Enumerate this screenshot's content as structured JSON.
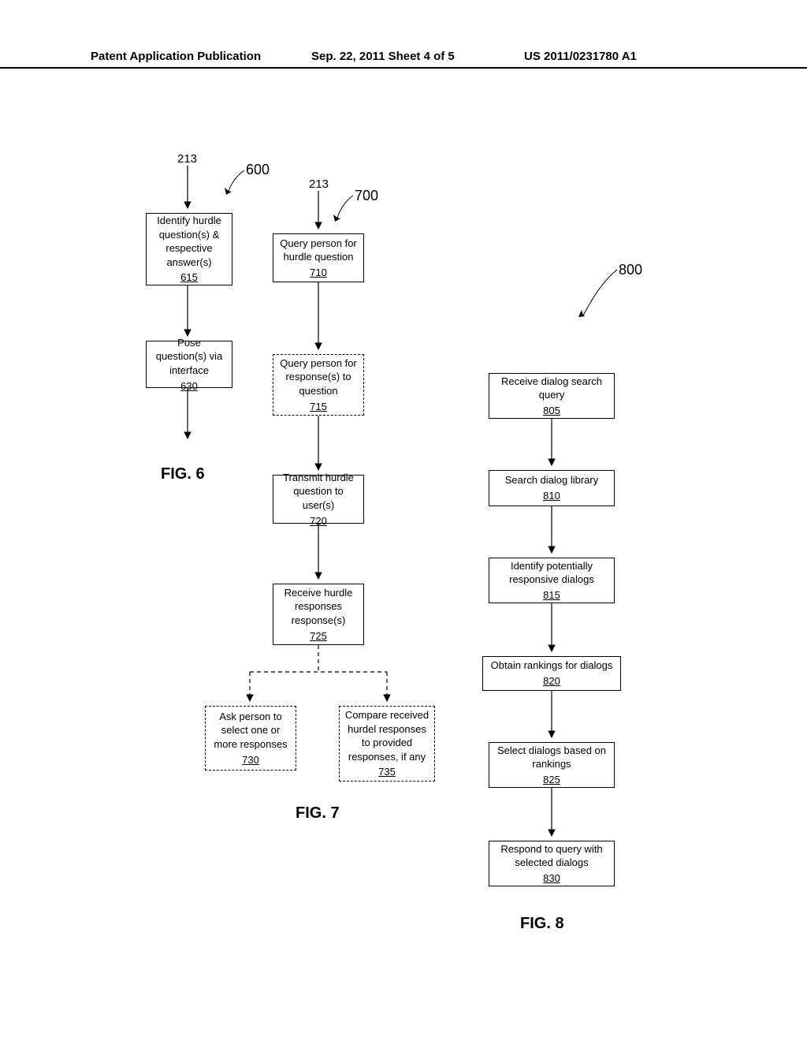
{
  "header": {
    "left": "Patent Application Publication",
    "center": "Sep. 22, 2011  Sheet 4 of 5",
    "right": "US 2011/0231780 A1"
  },
  "labels": {
    "l213a": "213",
    "l600": "600",
    "l213b": "213",
    "l700": "700",
    "l800": "800"
  },
  "fig6": {
    "b615": {
      "text": "Identify hurdle question(s) & respective answer(s)",
      "num": "615"
    },
    "b630": {
      "text": "Pose question(s) via interface",
      "num": "630"
    },
    "caption": "FIG. 6"
  },
  "fig7": {
    "b710": {
      "text": "Query person for hurdle question",
      "num": "710"
    },
    "b715": {
      "text": "Query person for response(s) to question",
      "num": "715"
    },
    "b720": {
      "text": "Transmit hurdle question to user(s)",
      "num": "720"
    },
    "b725": {
      "text": "Receive hurdle responses response(s)",
      "num": "725"
    },
    "b730": {
      "text": "Ask person to select one or more responses",
      "num": "730"
    },
    "b735": {
      "text": "Compare received hurdel responses to provided responses, if any",
      "num": "735"
    },
    "caption": "FIG. 7"
  },
  "fig8": {
    "b805": {
      "text": "Receive dialog search query",
      "num": "805"
    },
    "b810": {
      "text": "Search dialog library",
      "num": "810"
    },
    "b815": {
      "text": "Identify potentially responsive dialogs",
      "num": "815"
    },
    "b820": {
      "text": "Obtain rankings for dialogs",
      "num": "820"
    },
    "b825": {
      "text": "Select dialogs based on rankings",
      "num": "825"
    },
    "b830": {
      "text": "Respond to query with selected dialogs",
      "num": "830"
    },
    "caption": "FIG. 8"
  }
}
